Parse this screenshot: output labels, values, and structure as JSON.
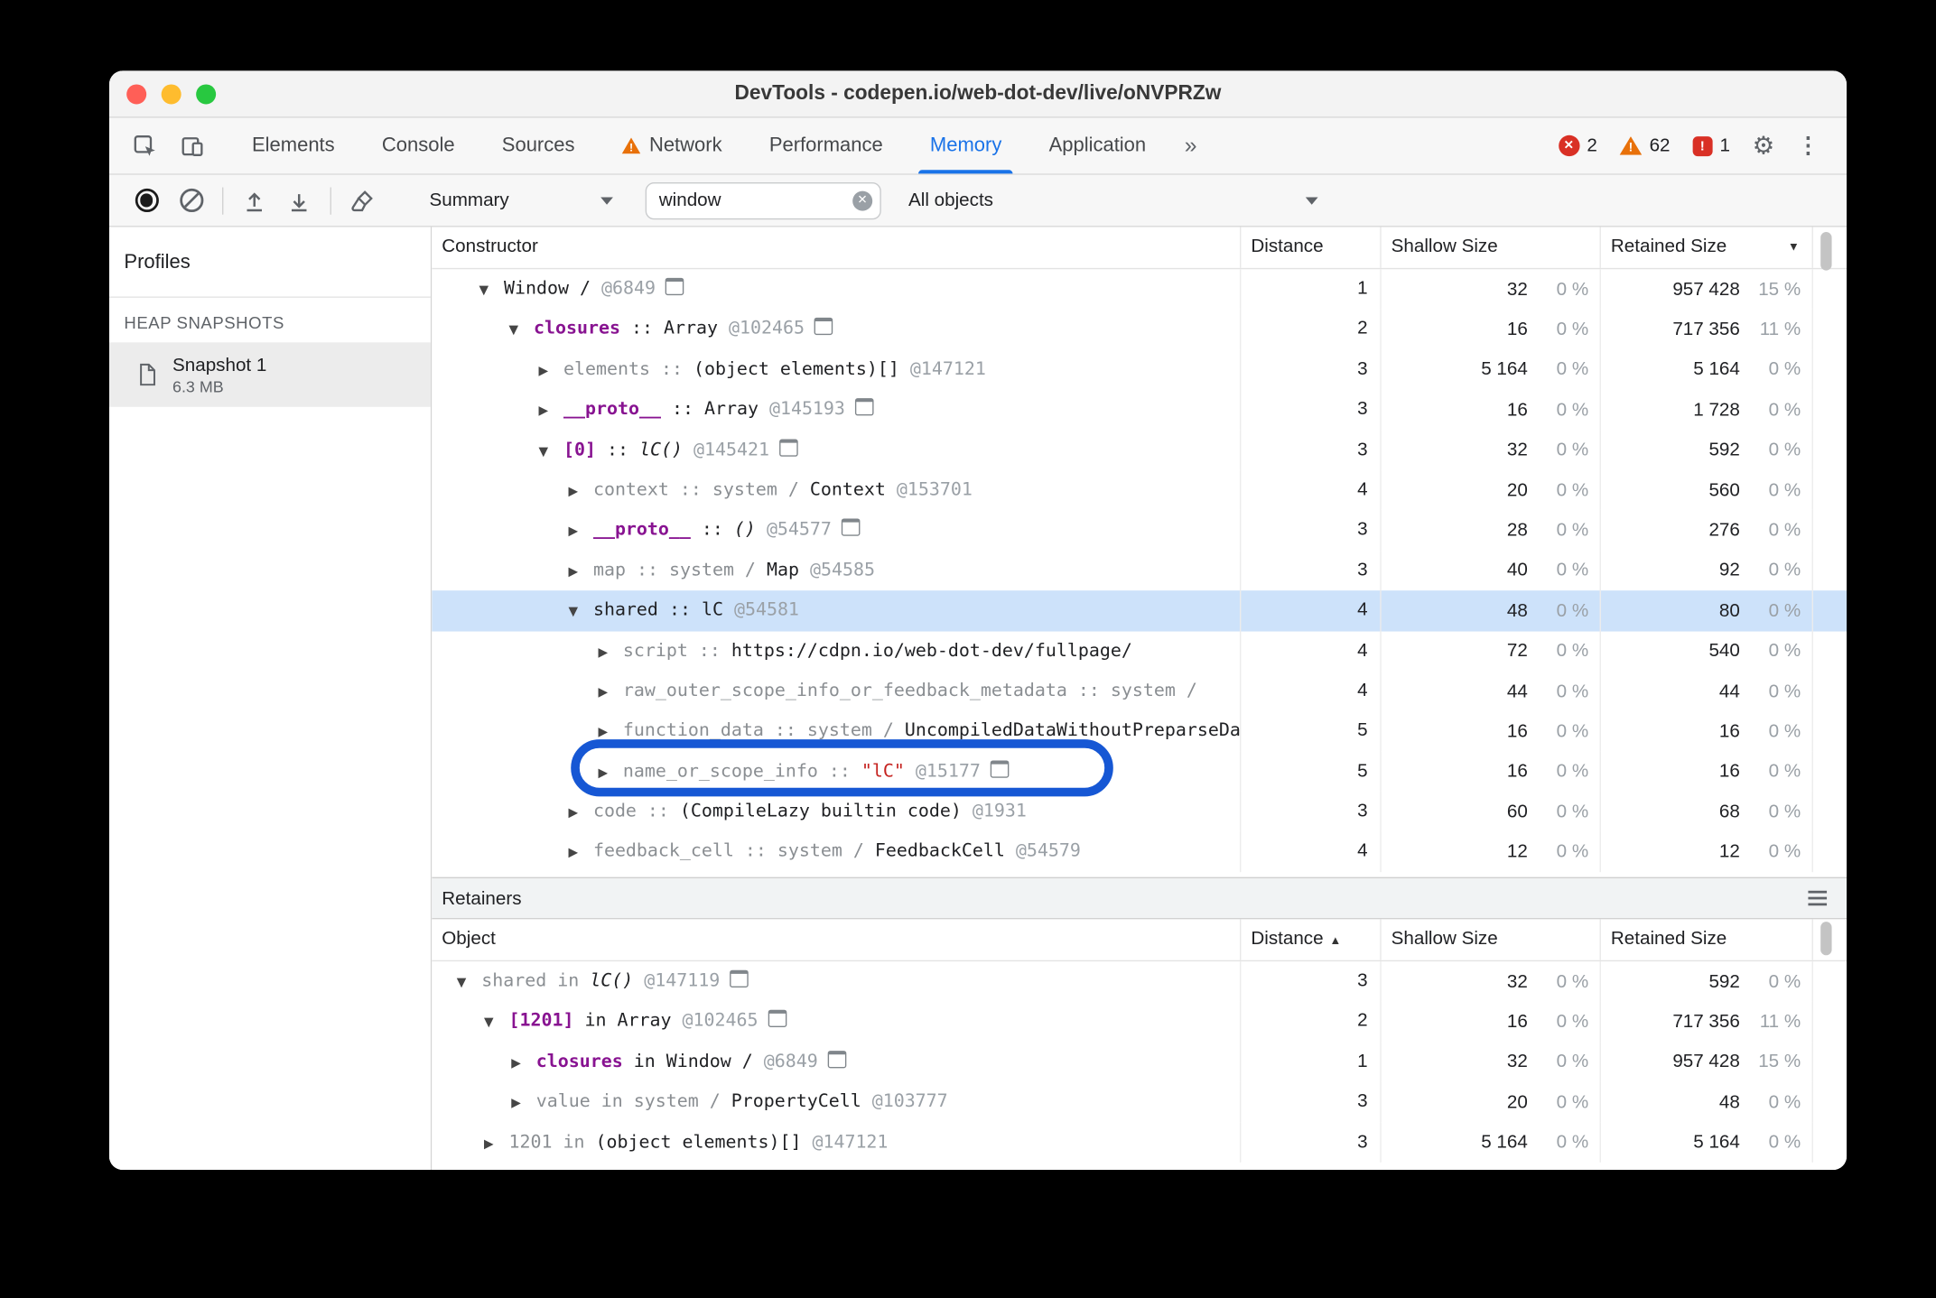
{
  "window": {
    "title": "DevTools - codepen.io/web-dot-dev/live/oNVPRZw"
  },
  "icons": {
    "more_tabs": "»",
    "gear": "⚙",
    "kebab": "⋮",
    "warning_glyph": "!",
    "error_glyph": "✕",
    "issue_glyph": "!",
    "clear_search_glyph": "✕"
  },
  "tabs": {
    "items": [
      {
        "label": "Elements"
      },
      {
        "label": "Console"
      },
      {
        "label": "Sources"
      },
      {
        "label": "Network",
        "warning_icon": true
      },
      {
        "label": "Performance"
      },
      {
        "label": "Memory",
        "active": true
      },
      {
        "label": "Application"
      }
    ]
  },
  "status": {
    "errors": "2",
    "warnings": "62",
    "issues": "1"
  },
  "toolbar": {
    "profile_view": "Summary",
    "search_value": "window",
    "object_filter": "All objects"
  },
  "sidebar": {
    "title": "Profiles",
    "section": "HEAP SNAPSHOTS",
    "snapshot": {
      "name": "Snapshot 1",
      "size": "6.3 MB"
    }
  },
  "constructor_grid": {
    "columns": [
      {
        "label": "Constructor"
      },
      {
        "label": "Distance"
      },
      {
        "label": "Shallow Size"
      },
      {
        "label": "Retained Size",
        "sort": "desc",
        "sort_right": true
      }
    ],
    "rows": [
      {
        "level": 0,
        "exp": "open",
        "icon": true,
        "segments": [
          {
            "t": "Window / ",
            "c": "plain"
          },
          {
            "t": " @6849",
            "c": "id"
          }
        ],
        "d": "1",
        "sv": "32",
        "sp": "0 %",
        "rv": "957 428",
        "rp": "15 %"
      },
      {
        "level": 1,
        "exp": "open",
        "icon": true,
        "segments": [
          {
            "t": "closures",
            "c": "prop"
          },
          {
            "t": " :: ",
            "c": "plain"
          },
          {
            "t": "Array",
            "c": "plain"
          },
          {
            "t": " @102465",
            "c": "id"
          }
        ],
        "d": "2",
        "sv": "16",
        "sp": "0 %",
        "rv": "717 356",
        "rp": "11 %"
      },
      {
        "level": 2,
        "exp": "closed",
        "icon": false,
        "segments": [
          {
            "t": "elements",
            "c": "dim"
          },
          {
            "t": " :: ",
            "c": "dim"
          },
          {
            "t": "(object elements)[]",
            "c": "plain"
          },
          {
            "t": " @147121",
            "c": "id"
          }
        ],
        "d": "3",
        "sv": "5 164",
        "sp": "0 %",
        "rv": "5 164",
        "rp": "0 %"
      },
      {
        "level": 2,
        "exp": "closed",
        "icon": true,
        "segments": [
          {
            "t": "__proto__",
            "c": "prop"
          },
          {
            "t": " :: ",
            "c": "plain"
          },
          {
            "t": "Array",
            "c": "plain"
          },
          {
            "t": " @145193",
            "c": "id"
          }
        ],
        "d": "3",
        "sv": "16",
        "sp": "0 %",
        "rv": "1 728",
        "rp": "0 %"
      },
      {
        "level": 2,
        "exp": "open",
        "icon": true,
        "segments": [
          {
            "t": "[0]",
            "c": "prop"
          },
          {
            "t": " :: ",
            "c": "plain"
          },
          {
            "t": "lC()",
            "c": "italic"
          },
          {
            "t": " @145421",
            "c": "id"
          }
        ],
        "d": "3",
        "sv": "32",
        "sp": "0 %",
        "rv": "592",
        "rp": "0 %"
      },
      {
        "level": 3,
        "exp": "closed",
        "icon": false,
        "segments": [
          {
            "t": "context",
            "c": "dim"
          },
          {
            "t": " :: ",
            "c": "dim"
          },
          {
            "t": "system / ",
            "c": "dim"
          },
          {
            "t": "Context",
            "c": "plain"
          },
          {
            "t": " @153701",
            "c": "id"
          }
        ],
        "d": "4",
        "sv": "20",
        "sp": "0 %",
        "rv": "560",
        "rp": "0 %"
      },
      {
        "level": 3,
        "exp": "closed",
        "icon": true,
        "segments": [
          {
            "t": "__proto__",
            "c": "prop"
          },
          {
            "t": " :: ",
            "c": "plain"
          },
          {
            "t": "()",
            "c": "italic"
          },
          {
            "t": " @54577",
            "c": "id"
          }
        ],
        "d": "3",
        "sv": "28",
        "sp": "0 %",
        "rv": "276",
        "rp": "0 %"
      },
      {
        "level": 3,
        "exp": "closed",
        "icon": false,
        "segments": [
          {
            "t": "map",
            "c": "dim"
          },
          {
            "t": " :: ",
            "c": "dim"
          },
          {
            "t": "system / ",
            "c": "dim"
          },
          {
            "t": "Map",
            "c": "plain"
          },
          {
            "t": " @54585",
            "c": "id"
          }
        ],
        "d": "3",
        "sv": "40",
        "sp": "0 %",
        "rv": "92",
        "rp": "0 %"
      },
      {
        "level": 3,
        "exp": "open",
        "icon": false,
        "selected": true,
        "segments": [
          {
            "t": "shared",
            "c": "plain"
          },
          {
            "t": " :: ",
            "c": "plain"
          },
          {
            "t": "lC",
            "c": "plain"
          },
          {
            "t": " @54581",
            "c": "id"
          }
        ],
        "d": "4",
        "sv": "48",
        "sp": "0 %",
        "rv": "80",
        "rp": "0 %"
      },
      {
        "level": 4,
        "exp": "closed",
        "icon": false,
        "segments": [
          {
            "t": "script",
            "c": "dim"
          },
          {
            "t": " :: ",
            "c": "dim"
          },
          {
            "t": "https://cdpn.io/web-dot-dev/fullpage/",
            "c": "plain"
          }
        ],
        "d": "4",
        "sv": "72",
        "sp": "0 %",
        "rv": "540",
        "rp": "0 %"
      },
      {
        "level": 4,
        "exp": "closed",
        "icon": false,
        "segments": [
          {
            "t": "raw_outer_scope_info_or_feedback_metadata",
            "c": "dim"
          },
          {
            "t": " :: ",
            "c": "dim"
          },
          {
            "t": "system / ",
            "c": "dim"
          }
        ],
        "d": "4",
        "sv": "44",
        "sp": "0 %",
        "rv": "44",
        "rp": "0 %"
      },
      {
        "level": 4,
        "exp": "closed",
        "icon": false,
        "segments": [
          {
            "t": "function_data",
            "c": "dim"
          },
          {
            "t": " :: ",
            "c": "dim"
          },
          {
            "t": "system / ",
            "c": "dim"
          },
          {
            "t": "UncompiledDataWithoutPreparseData",
            "c": "plain"
          }
        ],
        "d": "5",
        "sv": "16",
        "sp": "0 %",
        "rv": "16",
        "rp": "0 %"
      },
      {
        "level": 4,
        "exp": "closed",
        "icon": true,
        "circled": true,
        "segments": [
          {
            "t": "name_or_scope_info",
            "c": "dim"
          },
          {
            "t": " :: ",
            "c": "dim"
          },
          {
            "t": "\"lC\"",
            "c": "str"
          },
          {
            "t": " @15177",
            "c": "id"
          }
        ],
        "d": "5",
        "sv": "16",
        "sp": "0 %",
        "rv": "16",
        "rp": "0 %"
      },
      {
        "level": 3,
        "exp": "closed",
        "icon": false,
        "segments": [
          {
            "t": "code",
            "c": "dim"
          },
          {
            "t": " :: ",
            "c": "dim"
          },
          {
            "t": "(CompileLazy builtin code)",
            "c": "plain"
          },
          {
            "t": " @1931",
            "c": "id"
          }
        ],
        "d": "3",
        "sv": "60",
        "sp": "0 %",
        "rv": "68",
        "rp": "0 %"
      },
      {
        "level": 3,
        "exp": "closed",
        "icon": false,
        "segments": [
          {
            "t": "feedback_cell",
            "c": "dim"
          },
          {
            "t": " :: ",
            "c": "dim"
          },
          {
            "t": "system / ",
            "c": "dim"
          },
          {
            "t": "FeedbackCell",
            "c": "plain"
          },
          {
            "t": " @54579",
            "c": "id"
          }
        ],
        "d": "4",
        "sv": "12",
        "sp": "0 %",
        "rv": "12",
        "rp": "0 %"
      }
    ]
  },
  "retainers": {
    "title": "Retainers",
    "columns": [
      {
        "label": "Object"
      },
      {
        "label": "Distance",
        "sort": "asc"
      },
      {
        "label": "Shallow Size"
      },
      {
        "label": "Retained Size"
      }
    ],
    "rows": [
      {
        "level": 0,
        "exp": "open",
        "icon": true,
        "segments": [
          {
            "t": "shared",
            "c": "dim"
          },
          {
            "t": " in ",
            "c": "dim"
          },
          {
            "t": "lC()",
            "c": "italic"
          },
          {
            "t": " @147119",
            "c": "id"
          }
        ],
        "d": "3",
        "sv": "32",
        "sp": "0 %",
        "rv": "592",
        "rp": "0 %"
      },
      {
        "level": 1,
        "exp": "open",
        "icon": true,
        "segments": [
          {
            "t": "[1201]",
            "c": "prop"
          },
          {
            "t": " in ",
            "c": "plain"
          },
          {
            "t": "Array",
            "c": "plain"
          },
          {
            "t": " @102465",
            "c": "id"
          }
        ],
        "d": "2",
        "sv": "16",
        "sp": "0 %",
        "rv": "717 356",
        "rp": "11 %"
      },
      {
        "level": 2,
        "exp": "closed",
        "icon": true,
        "segments": [
          {
            "t": "closures",
            "c": "prop"
          },
          {
            "t": " in ",
            "c": "plain"
          },
          {
            "t": "Window / ",
            "c": "plain"
          },
          {
            "t": " @6849",
            "c": "id"
          }
        ],
        "d": "1",
        "sv": "32",
        "sp": "0 %",
        "rv": "957 428",
        "rp": "15 %"
      },
      {
        "level": 2,
        "exp": "closed",
        "icon": false,
        "segments": [
          {
            "t": "value",
            "c": "dim"
          },
          {
            "t": " in ",
            "c": "dim"
          },
          {
            "t": "system / ",
            "c": "dim"
          },
          {
            "t": "PropertyCell",
            "c": "plain"
          },
          {
            "t": " @103777",
            "c": "id"
          }
        ],
        "d": "3",
        "sv": "20",
        "sp": "0 %",
        "rv": "48",
        "rp": "0 %"
      },
      {
        "level": 1,
        "exp": "closed",
        "icon": false,
        "segments": [
          {
            "t": "1201",
            "c": "dim"
          },
          {
            "t": " in ",
            "c": "dim"
          },
          {
            "t": "(object elements)[]",
            "c": "plain"
          },
          {
            "t": " @147121",
            "c": "id"
          }
        ],
        "d": "3",
        "sv": "5 164",
        "sp": "0 %",
        "rv": "5 164",
        "rp": "0 %"
      }
    ]
  }
}
